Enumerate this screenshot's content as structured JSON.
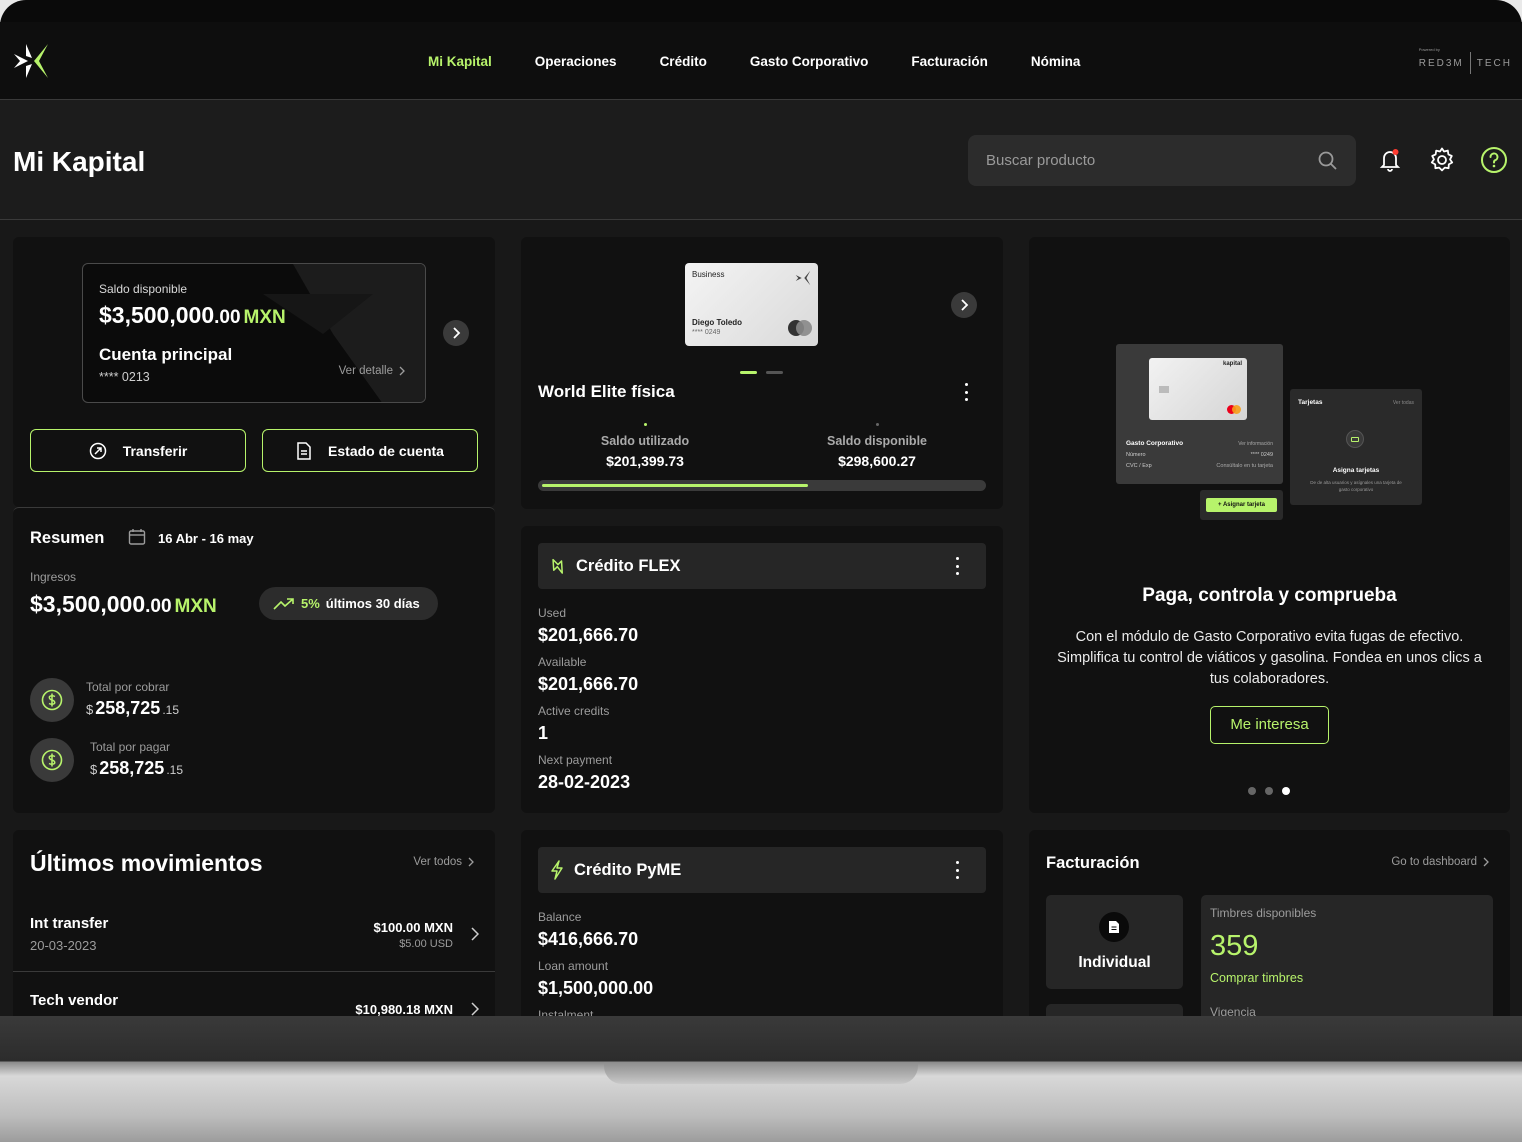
{
  "nav": {
    "items": [
      {
        "label": "Mi Kapital",
        "active": true
      },
      {
        "label": "Operaciones",
        "active": false
      },
      {
        "label": "Crédito",
        "active": false
      },
      {
        "label": "Gasto Corporativo",
        "active": false
      },
      {
        "label": "Facturación",
        "active": false
      },
      {
        "label": "Nómina",
        "active": false
      }
    ],
    "powered_small": "Powered by",
    "brand_left": "RED3M",
    "brand_right": "TECH"
  },
  "header": {
    "title": "Mi Kapital",
    "search_placeholder": "Buscar producto"
  },
  "account": {
    "saldo_label": "Saldo disponible",
    "saldo_main": "$3,500,000",
    "saldo_cents": ".00",
    "currency": "MXN",
    "name": "Cuenta principal",
    "number": "**** 0213",
    "detail_link": "Ver detalle",
    "transfer_label": "Transferir",
    "statement_label": "Estado de cuenta"
  },
  "summary": {
    "title": "Resumen",
    "date_range": "16 Abr - 16 may",
    "income_label": "Ingresos",
    "income_main": "$3,500,000",
    "income_cents": ".00",
    "currency": "MXN",
    "trend_pct": "5%",
    "trend_text": "últimos 30 días",
    "receivable_label": "Total por cobrar",
    "receivable_main": "258,725",
    "receivable_cents": ".15",
    "payable_label": "Total por pagar",
    "payable_main": "258,725",
    "payable_cents": ".15",
    "dollar_sign": "$"
  },
  "movements": {
    "title": "Últimos movimientos",
    "view_all": "Ver todos",
    "items": [
      {
        "name": "Int transfer",
        "date": "20-03-2023",
        "amount": "$100.00 MXN",
        "amount_usd": "$5.00 USD"
      },
      {
        "name": "Tech vendor",
        "date": "",
        "amount": "$10,980.18 MXN",
        "amount_usd": ""
      }
    ]
  },
  "elite": {
    "card_type": "Business",
    "holder": "Diego Toledo",
    "card_number": "**** 0249",
    "network": "mastercard",
    "title": "World Elite física",
    "used_label": "Saldo utilizado",
    "used_value": "$201,399.73",
    "available_label": "Saldo disponible",
    "available_value": "$298,600.27",
    "used_fraction": 0.605
  },
  "flex": {
    "title": "Crédito FLEX",
    "used_label": "Used",
    "used_value": "$201,666.70",
    "available_label": "Available",
    "available_value": "$201,666.70",
    "active_label": "Active credits",
    "active_value": "1",
    "next_label": "Next payment",
    "next_value": "28-02-2023"
  },
  "pyme": {
    "title": "Crédito PyME",
    "balance_label": "Balance",
    "balance_value": "$416,666.70",
    "loan_label": "Loan amount",
    "loan_value": "$1,500,000.00",
    "instalment_label": "Instalment"
  },
  "promo": {
    "mock_card_brand": "kapital",
    "mock_section": "Gasto Corporativo",
    "mock_more": "Ver información",
    "mock_number_label": "Número",
    "mock_number": "**** 0249",
    "mock_cvc_label": "CVC / Exp",
    "mock_cvc_value": "Consúltalo en tu tarjeta",
    "mock_cards_title": "Tarjetas",
    "mock_cards_link": "Ver todas",
    "mock_assign_title": "Asigna tarjetas",
    "mock_assign_text": "De de alta usuarios y asígnales una tarjeta de gasto corporativo",
    "mock_assign_btn": "+ Asignar tarjeta",
    "title": "Paga, controla y comprueba",
    "body": "Con el módulo de Gasto Corporativo evita fugas de efectivo. Simplifica tu control de viáticos y gasolina. Fondea en unos clics a tus colaboradores.",
    "cta": "Me interesa"
  },
  "billing": {
    "title": "Facturación",
    "link": "Go to dashboard",
    "individual_label": "Individual",
    "stamps_label": "Timbres disponibles",
    "stamps_value": "359",
    "buy_label": "Comprar timbres",
    "validity_label": "Vigencia"
  },
  "colors": {
    "accent": "#b7f36b",
    "background": "#181818",
    "card": "#111111"
  }
}
